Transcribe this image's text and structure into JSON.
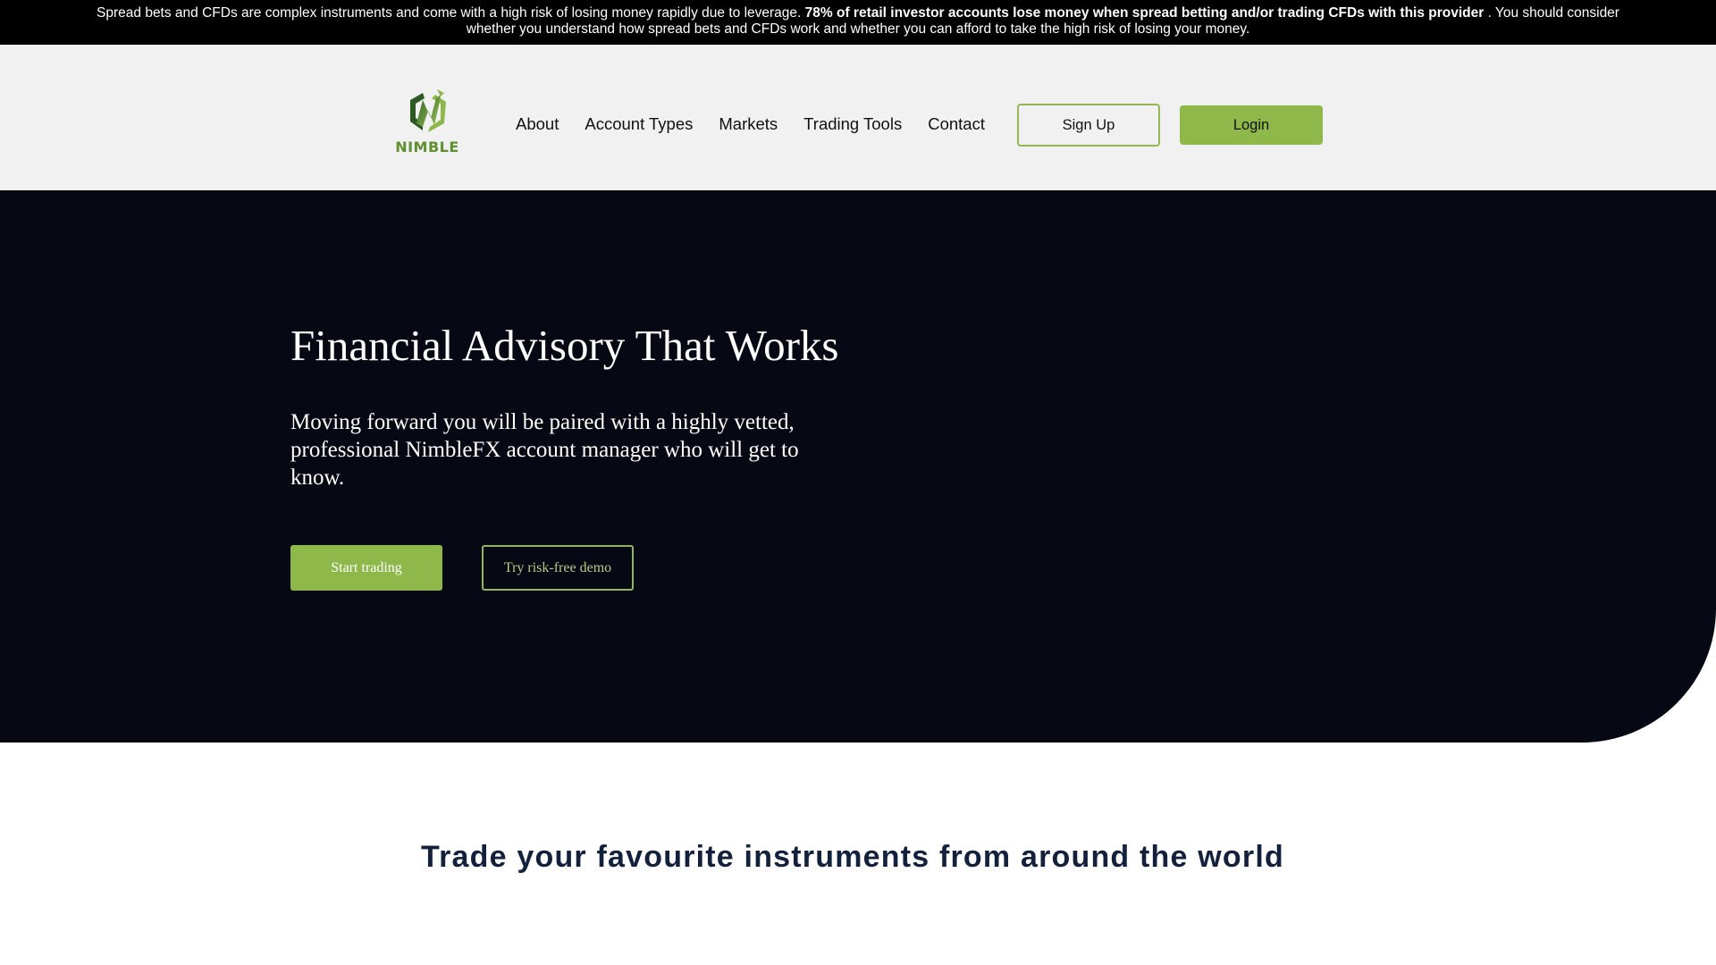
{
  "risk_banner": {
    "text_before": "Spread bets and CFDs are complex instruments and come with a high risk of losing money rapidly due to leverage. ",
    "text_bold": "78% of retail investor accounts lose money when spread betting and/or trading CFDs with this provider",
    "text_after": " . You should consider whether you understand how spread bets and CFDs work and whether you can afford to take the high risk of losing your money."
  },
  "header": {
    "logo": {
      "icon": "nimble-n-hexagon-logo",
      "text": "NIMBLE"
    },
    "nav": [
      {
        "label": "About"
      },
      {
        "label": "Account Types"
      },
      {
        "label": "Markets"
      },
      {
        "label": "Trading Tools"
      },
      {
        "label": "Contact"
      }
    ],
    "signup_label": "Sign Up",
    "login_label": "Login"
  },
  "hero": {
    "title": "Financial Advisory That Works",
    "subtitle": "Moving forward you will be paired with a highly vetted, professional NimbleFX account manager who will get to know.",
    "primary_cta": "Start trading",
    "secondary_cta": "Try risk-free demo"
  },
  "instruments": {
    "title": "Trade your favourite instruments from around the world"
  },
  "colors": {
    "accent": "#8fb84b",
    "hero_bg": "#060913",
    "nav_bg": "#f1f1f2",
    "heading_navy": "#14213d"
  }
}
